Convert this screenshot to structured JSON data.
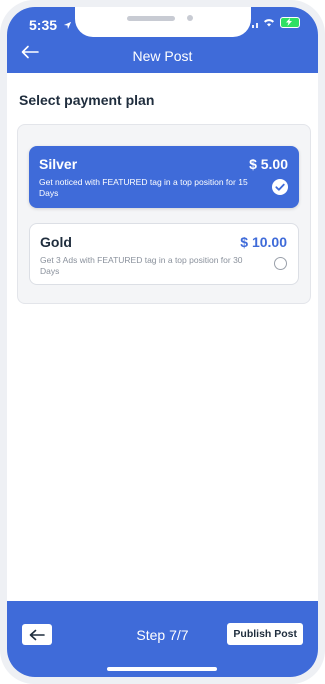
{
  "status_bar": {
    "time": "5:35"
  },
  "header": {
    "title": "New Post"
  },
  "section_title": "Select payment plan",
  "plans": [
    {
      "name": "Silver",
      "price": "$ 5.00",
      "description": "Get noticed with FEATURED tag in a top position for 15 Days",
      "selected": true
    },
    {
      "name": "Gold",
      "price": "$ 10.00",
      "description": "Get 3 Ads with FEATURED tag in a top position for 30 Days",
      "selected": false
    }
  ],
  "footer": {
    "step_label": "Step 7/7",
    "publish_label": "Publish Post"
  },
  "colors": {
    "primary": "#3f6bd9",
    "text_dark": "#1f2d3d",
    "text_muted": "#8a919c"
  }
}
